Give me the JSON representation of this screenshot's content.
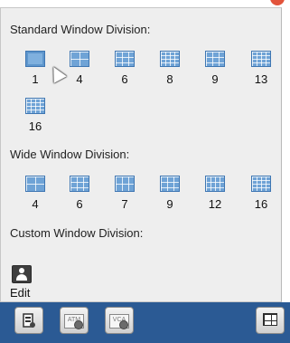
{
  "panel": {
    "standard_title": "Standard Window Division:",
    "standard_layouts": [
      "1",
      "4",
      "6",
      "8",
      "9",
      "13",
      "16"
    ],
    "wide_title": "Wide Window Division:",
    "wide_layouts": [
      "4",
      "6",
      "7",
      "9",
      "12",
      "16"
    ],
    "custom_title": "Custom Window Division:",
    "custom_edit_label": "Edit"
  },
  "toolbar": {
    "atm_label": "ATM",
    "vca_label": "VCA"
  },
  "colors": {
    "layout_icon": "#5e96cc",
    "toolbar_bg": "#2b5a94",
    "panel_bg": "#eeeeee"
  }
}
